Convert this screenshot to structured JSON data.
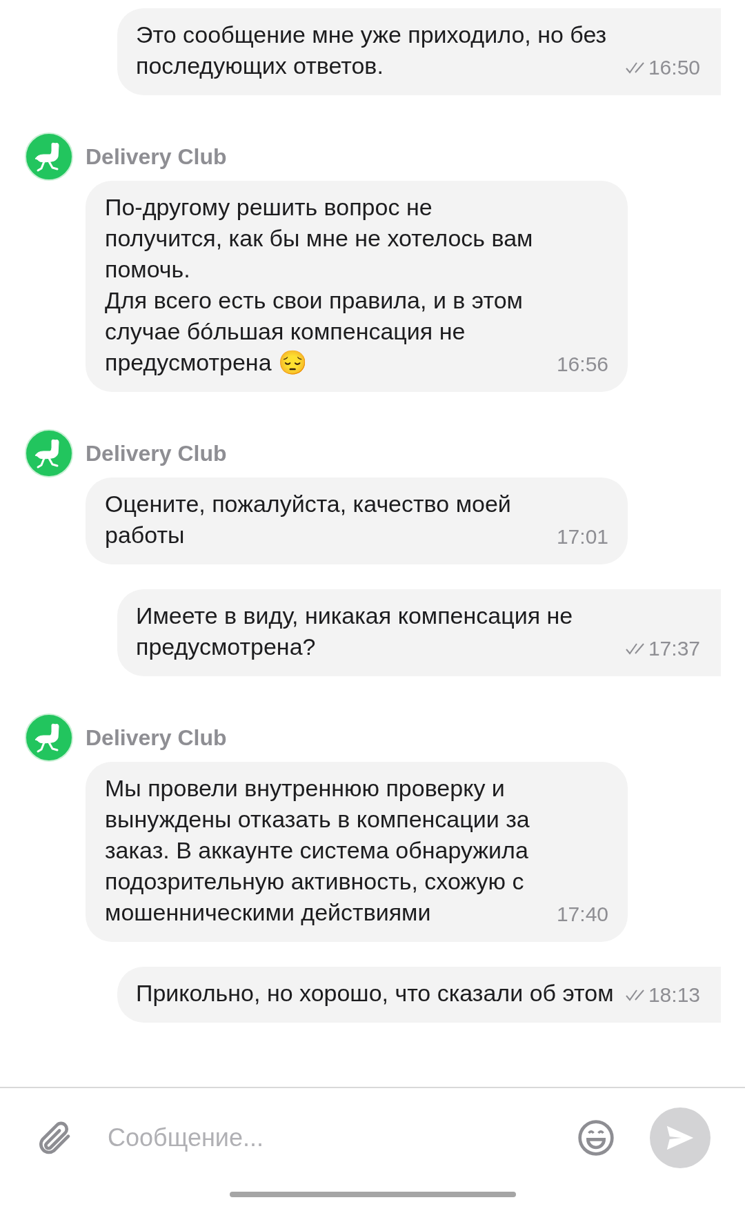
{
  "messages": [
    {
      "kind": "outgoing",
      "text": "Это сообщение мне уже приходило, но без последующих ответов.",
      "time": "16:50",
      "read": true
    },
    {
      "kind": "incoming",
      "sender": "Delivery Club",
      "text": "По-другому решить вопрос не получится, как бы мне не хотелось вам помочь.\nДля всего есть свои правила, и в этом случае бóльшая компенсация не предусмотрена 😔",
      "time": "16:56"
    },
    {
      "kind": "incoming",
      "sender": "Delivery Club",
      "text": "Оцените, пожалуйста, качество моей работы",
      "time": "17:01"
    },
    {
      "kind": "outgoing",
      "text": "Имеете в виду, никакая компенсация не предусмотрена?",
      "time": "17:37",
      "read": true
    },
    {
      "kind": "incoming",
      "sender": "Delivery Club",
      "text": "Мы провели внутреннюю проверку и вынуждены отказать в компенсации за заказ. В аккаунте система обнаружила подозрительную активность, схожую с мошенническими действиями",
      "time": "17:40"
    },
    {
      "kind": "outgoing",
      "text": "Прикольно, но хорошо, что сказали об этом",
      "time": "18:13",
      "read": true
    }
  ],
  "composer": {
    "placeholder": "Сообщение..."
  }
}
